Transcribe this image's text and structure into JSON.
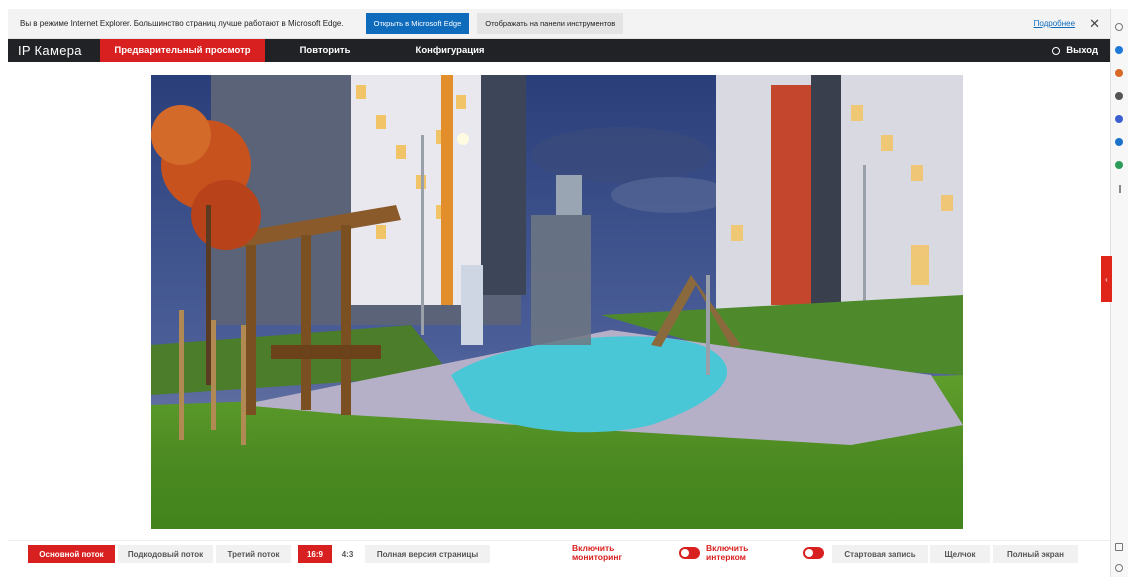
{
  "ie_banner": {
    "message": "Вы в режиме Internet Explorer. Большинство страниц лучше работают в Microsoft Edge.",
    "open_edge": "Открыть в Microsoft Edge",
    "show_toolbar": "Отображать на панели инструментов",
    "more": "Подробнее",
    "close": "✕"
  },
  "header": {
    "brand": "IP Камера",
    "tabs": [
      "Предварительный просмотр",
      "Повторить",
      "Конфигурация"
    ],
    "logout": "Выход"
  },
  "side_tab_glyph": "‹",
  "toolbar": {
    "streams": [
      "Основной поток",
      "Подкодовый поток",
      "Третий поток"
    ],
    "aspect": [
      "16:9",
      "4:3"
    ],
    "full_page": "Полная версия страницы",
    "monitoring": "Включить мониторинг",
    "intercom": "Включить интерком",
    "start_record": "Стартовая запись",
    "snapshot": "Щелчок",
    "fullscreen": "Полный экран"
  },
  "colors": {
    "accent": "#d7201f",
    "header_bg": "#202226",
    "edge_blue": "#0f6cbd"
  },
  "icons": {
    "logout": "power-icon",
    "close": "close-icon"
  }
}
